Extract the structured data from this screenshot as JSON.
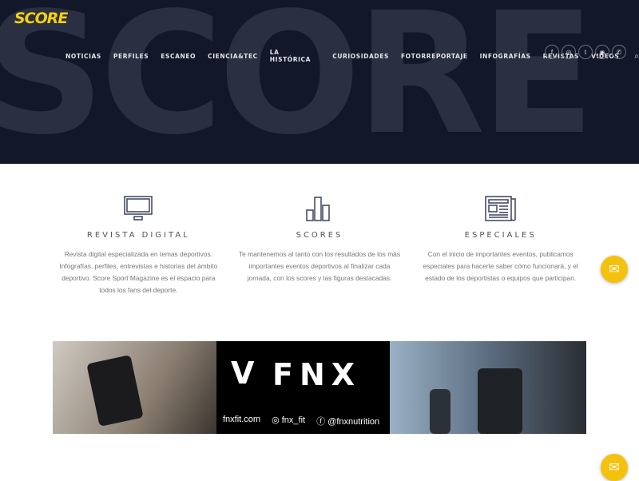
{
  "header": {
    "logo": "SCORE",
    "bg_word": "SCORE",
    "nav": [
      "NOTICIAS",
      "PERFILES",
      "ESCANEO",
      "CIENCIA&TEC",
      "LA HISTÓRICA",
      "CURIOSIDADES",
      "FOTORREPORTAJE",
      "INFOGRAFÍAS",
      "REVISTAS",
      "VIDEOS"
    ],
    "search_icon": "⌕",
    "social": [
      "f",
      "◎",
      "t",
      "◉",
      "✆"
    ]
  },
  "features": [
    {
      "title": "REVISTA DIGITAL",
      "text": "Revista digital especializada en temas deportivos. Infografías, perfiles, entrevistas e historias del ámbito deportivo. Score Sport Magazine es el espacio para todos los fans del deporte."
    },
    {
      "title": "SCORES",
      "text": "Te mantenemos al tanto con los resultados de los más importantes eventos deportivos al finalizar cada jornada, con los scores y las figuras destacadas."
    },
    {
      "title": "ESPECIALES",
      "text": "Con el inicio de importantes eventos, publicamos especiales para hacerte saber cómo funcionará, y el estado de los deportistas o equipos que participan."
    }
  ],
  "banner": {
    "brand": "FNX",
    "mark": "Ⅴ",
    "site": "fnxfit.com",
    "instagram": "fnx_fit",
    "facebook": "@fnxnutrition",
    "ig_icon": "◎",
    "fb_icon": "ⓕ"
  },
  "messenger_icon": "✉"
}
